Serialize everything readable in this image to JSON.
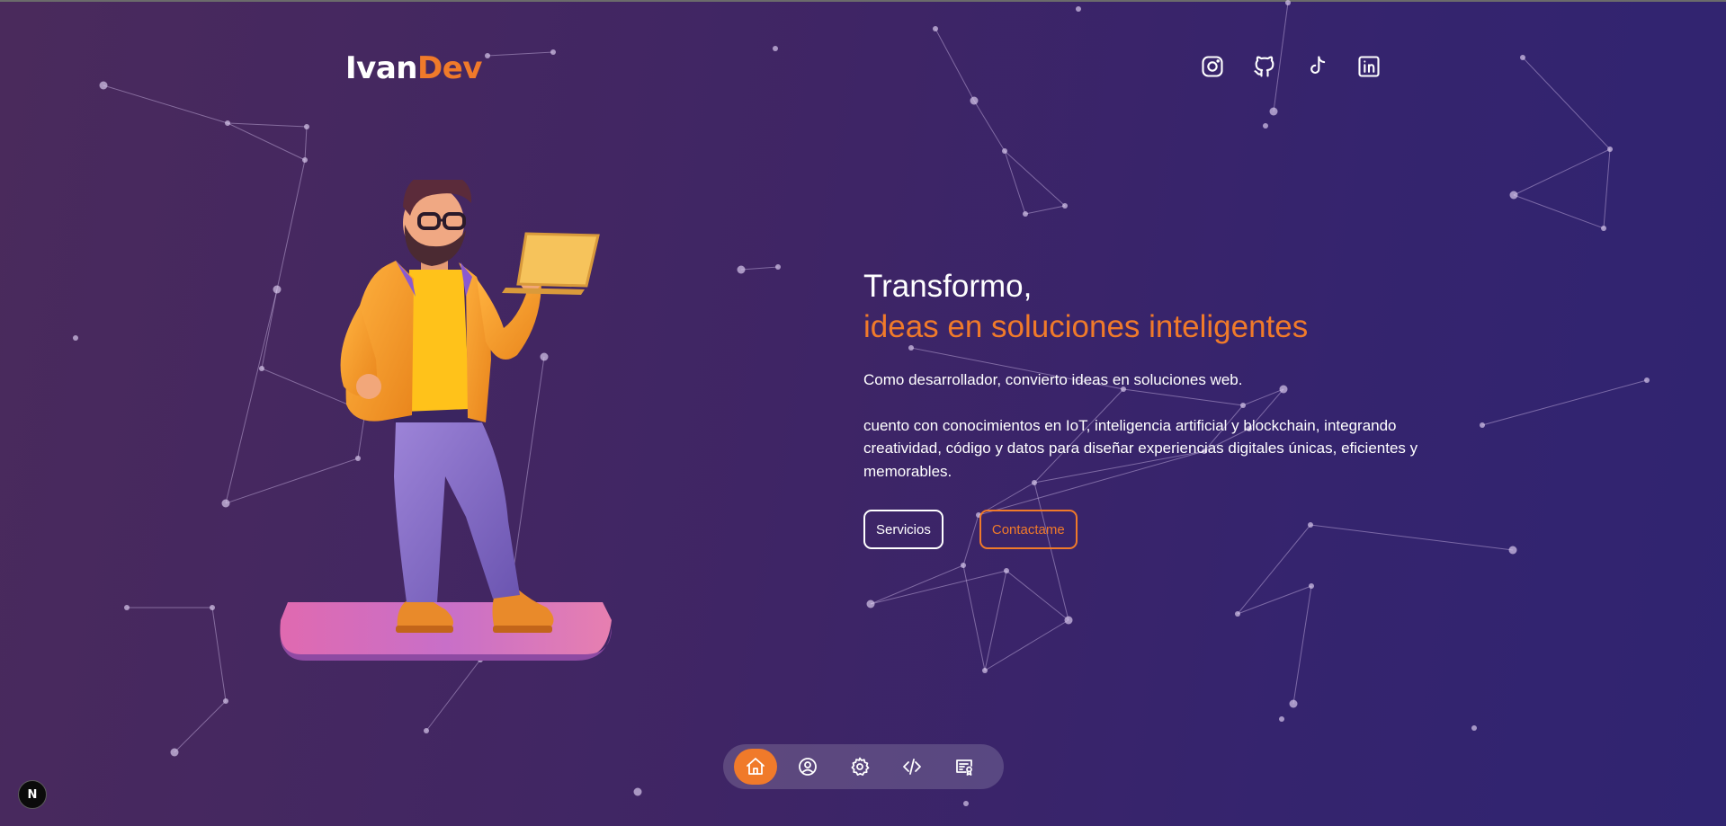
{
  "brand": {
    "first": "Ivan",
    "second": "Dev"
  },
  "social": [
    {
      "name": "instagram-icon"
    },
    {
      "name": "github-icon"
    },
    {
      "name": "tiktok-icon"
    },
    {
      "name": "linkedin-icon"
    }
  ],
  "hero": {
    "title": "Transformo,",
    "subtitle": "ideas en soluciones inteligentes",
    "paragraph1": "Como desarrollador, convierto ideas en soluciones web.",
    "paragraph2": "cuento con conocimientos en IoT, inteligencia artificial y blockchain, integrando creatividad, código y datos para diseñar experiencias digitales únicas, eficientes y memorables.",
    "button_primary": "Servicios",
    "button_secondary": "Contactame"
  },
  "dock": [
    {
      "name": "home-icon",
      "active": true
    },
    {
      "name": "user-icon",
      "active": false
    },
    {
      "name": "gear-icon",
      "active": false
    },
    {
      "name": "code-icon",
      "active": false
    },
    {
      "name": "certificate-icon",
      "active": false
    }
  ],
  "framework_badge": "N",
  "colors": {
    "accent": "#f07a2a",
    "background_start": "#4a2a5c",
    "background_end": "#302471"
  }
}
